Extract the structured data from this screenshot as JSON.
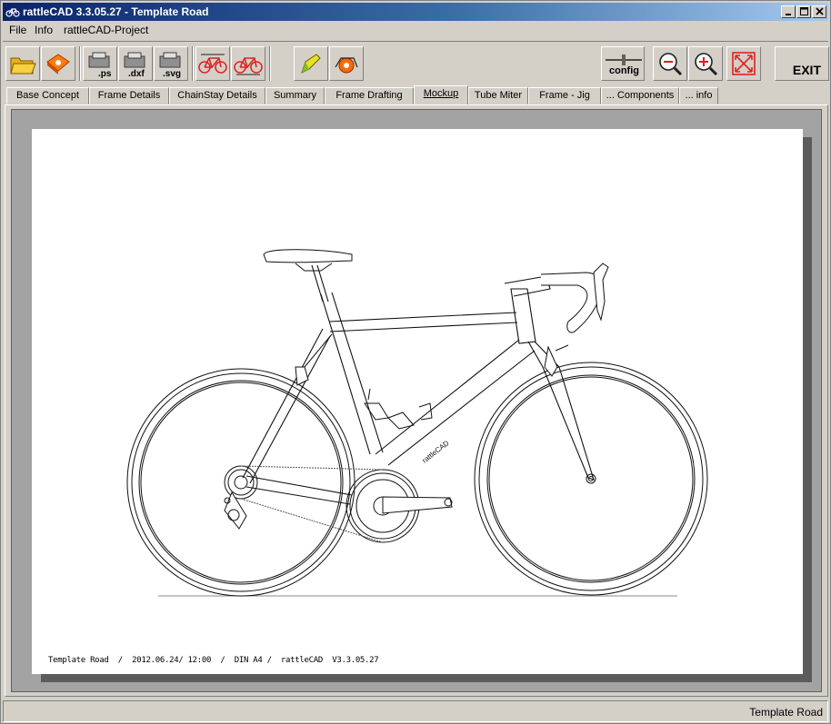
{
  "window": {
    "title": "rattleCAD  3.3.05.27 - Template Road",
    "buttons": [
      "minimize",
      "maximize",
      "close"
    ]
  },
  "menu": {
    "items": [
      {
        "label": "File"
      },
      {
        "label": "Info"
      },
      {
        "label": "rattleCAD-Project"
      }
    ]
  },
  "toolbar": {
    "buttons": [
      {
        "name": "open-folder-icon"
      },
      {
        "name": "save-disk-icon"
      },
      {
        "name": "export-ps-icon",
        "label": ".ps"
      },
      {
        "name": "export-dxf-icon",
        "label": ".dxf"
      },
      {
        "name": "export-svg-icon",
        "label": ".svg"
      },
      {
        "name": "bike-frame-icon"
      },
      {
        "name": "bike-frame-alt-icon"
      },
      {
        "name": "pencil-icon"
      },
      {
        "name": "render-bike-icon"
      }
    ],
    "config_label": "config",
    "exit_label": "EXIT"
  },
  "tabs": [
    {
      "label": "Base Concept"
    },
    {
      "label": "Frame Details"
    },
    {
      "label": "ChainStay Details"
    },
    {
      "label": "Summary"
    },
    {
      "label": "Frame Drafting"
    },
    {
      "label": "Mockup",
      "active": true
    },
    {
      "label": "Tube Miter"
    },
    {
      "label": "Frame - Jig"
    },
    {
      "label": "... Components"
    },
    {
      "label": "... info"
    }
  ],
  "drawing": {
    "footer": "Template Road  /  2012.06.24/ 12:00  /  DIN A4 /  rattleCAD  V3.3.05.27",
    "brand_text": "rattleCAD"
  },
  "status": {
    "text": "Template Road"
  },
  "colors": {
    "titlebar_start": "#0a246a",
    "titlebar_end": "#a6caf0",
    "chrome": "#d4d0c8",
    "canvas_bg": "#a3a3a3",
    "paper": "#ffffff",
    "accent_red": "#e02020",
    "accent_orange": "#ff6a00"
  }
}
